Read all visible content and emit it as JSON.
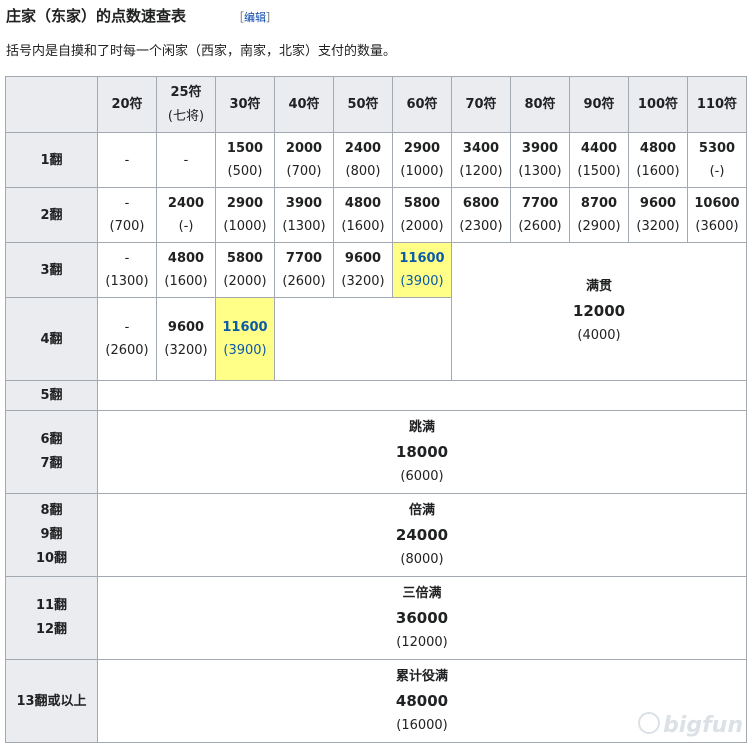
{
  "heading": {
    "title": "庄家（东家）的点数速查表",
    "edit_prefix": "［",
    "edit_label": "编辑",
    "edit_suffix": "］"
  },
  "description": "括号内是自摸和了时每一个闲家（西家，南家，北家）支付的数量。",
  "columns": [
    {
      "label": "20符",
      "sub": ""
    },
    {
      "label": "25符",
      "sub": "(七将)"
    },
    {
      "label": "30符",
      "sub": ""
    },
    {
      "label": "40符",
      "sub": ""
    },
    {
      "label": "50符",
      "sub": ""
    },
    {
      "label": "60符",
      "sub": ""
    },
    {
      "label": "70符",
      "sub": ""
    },
    {
      "label": "80符",
      "sub": ""
    },
    {
      "label": "90符",
      "sub": ""
    },
    {
      "label": "100符",
      "sub": ""
    },
    {
      "label": "110符",
      "sub": ""
    }
  ],
  "rows": {
    "r1": {
      "label": "1翻",
      "cells": [
        {
          "main": "-",
          "sub": ""
        },
        {
          "main": "-",
          "sub": ""
        },
        {
          "main": "1500",
          "sub": "(500)"
        },
        {
          "main": "2000",
          "sub": "(700)"
        },
        {
          "main": "2400",
          "sub": "(800)"
        },
        {
          "main": "2900",
          "sub": "(1000)"
        },
        {
          "main": "3400",
          "sub": "(1200)"
        },
        {
          "main": "3900",
          "sub": "(1300)"
        },
        {
          "main": "4400",
          "sub": "(1500)"
        },
        {
          "main": "4800",
          "sub": "(1600)"
        },
        {
          "main": "5300",
          "sub": "(-)"
        }
      ]
    },
    "r2": {
      "label": "2翻",
      "cells": [
        {
          "main": "-",
          "sub": "(700)"
        },
        {
          "main": "2400",
          "sub": "(-)"
        },
        {
          "main": "2900",
          "sub": "(1000)"
        },
        {
          "main": "3900",
          "sub": "(1300)"
        },
        {
          "main": "4800",
          "sub": "(1600)"
        },
        {
          "main": "5800",
          "sub": "(2000)"
        },
        {
          "main": "6800",
          "sub": "(2300)"
        },
        {
          "main": "7700",
          "sub": "(2600)"
        },
        {
          "main": "8700",
          "sub": "(2900)"
        },
        {
          "main": "9600",
          "sub": "(3200)"
        },
        {
          "main": "10600",
          "sub": "(3600)"
        }
      ]
    },
    "r3": {
      "label": "3翻",
      "cells": [
        {
          "main": "-",
          "sub": "(1300)"
        },
        {
          "main": "4800",
          "sub": "(1600)"
        },
        {
          "main": "5800",
          "sub": "(2000)"
        },
        {
          "main": "7700",
          "sub": "(2600)"
        },
        {
          "main": "9600",
          "sub": "(3200)"
        },
        {
          "main": "11600",
          "sub": "(3900)"
        }
      ]
    },
    "r4": {
      "label": "4翻",
      "cells": [
        {
          "main": "-",
          "sub": "(2600)"
        },
        {
          "main": "9600",
          "sub": "(3200)"
        },
        {
          "main": "11600",
          "sub": "(3900)"
        }
      ]
    },
    "r5": {
      "label": "5翻"
    }
  },
  "limits": {
    "mangan": {
      "name": "满贯",
      "points": "12000",
      "each": "(4000)"
    },
    "haneman": {
      "labels": [
        "6翻",
        "7翻"
      ],
      "name": "跳满",
      "points": "18000",
      "each": "(6000)"
    },
    "baiman": {
      "labels": [
        "8翻",
        "9翻",
        "10翻"
      ],
      "name": "倍满",
      "points": "24000",
      "each": "(8000)"
    },
    "sanbaiman": {
      "labels": [
        "11翻",
        "12翻"
      ],
      "name": "三倍满",
      "points": "36000",
      "each": "(12000)"
    },
    "yakuman": {
      "label": "13翻或以上",
      "name": "累计役满",
      "points": "48000",
      "each": "(16000)"
    }
  },
  "highlight_color": "#ffff88",
  "watermark": "bigfun"
}
